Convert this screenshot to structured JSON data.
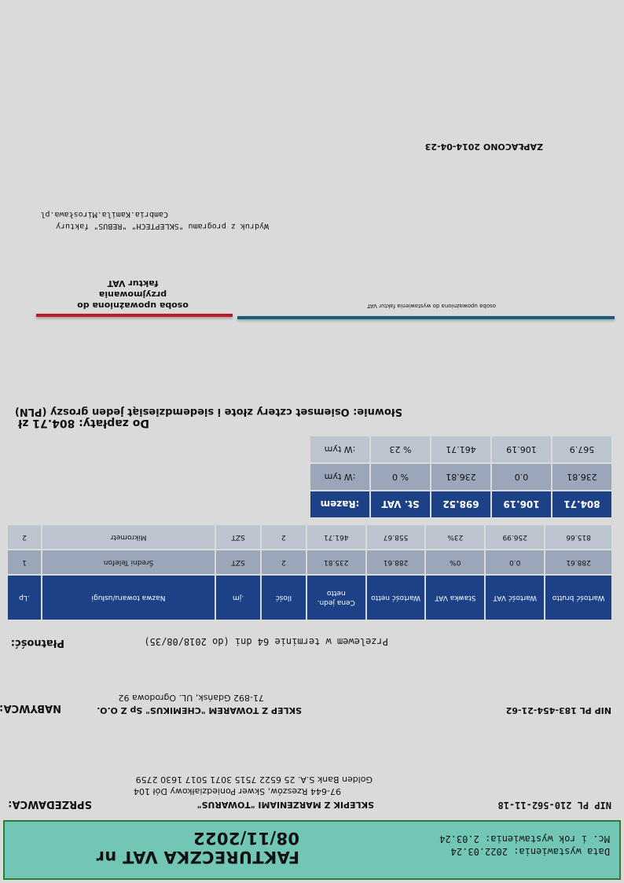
{
  "header": {
    "title": "FAKTURECZKA VAT nr 08/11/2022",
    "issue_date": "Data wystawienia: 2022.03.24",
    "issue_place": "Mc. i rok wystawienia: 2.03.24"
  },
  "seller": {
    "label": "SPRZEDAWCA:",
    "name": "SKLEPIK Z MARZENIAMI \"TOWARUS\"",
    "address": "97-644 Rzeszów, Skwer Poniedziałkowy Dół 104",
    "bank": "Golden Bank S.A. 25 6522 7515 3071 5017 1630 2759",
    "nip": "NIP PL 210-562-11-18"
  },
  "buyer": {
    "label": "NABYWCA:",
    "name": "SKLEP Z TOWAREM \"CHEMIKUS\" Sp Z O.O.",
    "address": "71-892 Gdańsk, UL. Ogrodowa 92",
    "nip": "NIP PL 183-454-21-62"
  },
  "payment": {
    "label": "Płatność:",
    "value": "Przelewem w terminie 64 dni (do 2018/08/35)"
  },
  "items_table": {
    "columns": [
      "Lp.",
      "Nazwa towaru/usługi",
      "jm.",
      "Ilość",
      "Cena jedn. netto",
      "Wartość netto",
      "Stawka VAT",
      "Wartość VAT",
      "Wartość brutto"
    ],
    "rows": [
      [
        "1",
        "Średni Telefon",
        "SZT",
        "2",
        "235.81",
        "288.61",
        "0%",
        "0.0",
        "288.61"
      ],
      [
        "2",
        "Mikrometr",
        "SZT",
        "2",
        "461.71",
        "558.67",
        "23%",
        "256.99",
        "815.66"
      ]
    ]
  },
  "summary": {
    "total": [
      "Razem:",
      "St. VAT",
      "698.52",
      "106.19",
      "804.71"
    ],
    "rate0": [
      "W tym:",
      "0 %",
      "236.81",
      "0.0",
      "236.81"
    ],
    "rate23": [
      "W tym:",
      "23 %",
      "461.71",
      "106.19",
      "567.9"
    ]
  },
  "amount_due": "Do zapłaty: 804.71 zł",
  "amount_words": "Słownie: Osiemset cztery złote i siedemdziesiąt jeden groszy (PLN)",
  "signatures": {
    "left_caption": "osoba upoważniona do wystawienia faktur VAT",
    "right_caption_1": "osoba upoważniona do przyjmowania",
    "right_caption_2": "faktur VAT"
  },
  "footer": {
    "printout": "Wydruk z programu \"SKLEPTECH\" \"REBUS\" faktury",
    "contact": "Cambria.Kamila.Mirosława.pl"
  },
  "paid_stamp": "ZAPŁACONO 2014-04-23",
  "colors": {
    "header_band": "#72c6b6",
    "table_header": "#1c4186",
    "row_odd": "#9aa6ba",
    "row_even": "#bcc4d0",
    "page_bg": "#dadada",
    "signature_left_line": "#1f5a78",
    "signature_right_line": "#c0192a"
  }
}
